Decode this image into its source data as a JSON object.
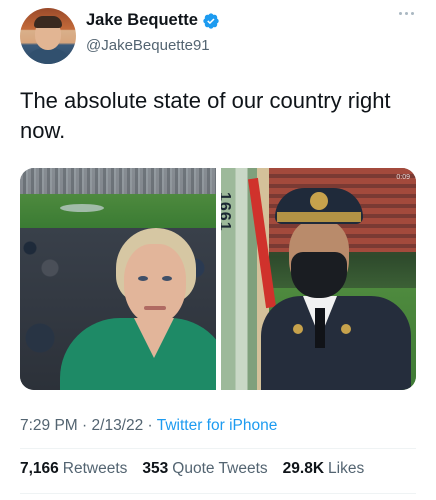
{
  "author": {
    "display_name": "Jake Bequette",
    "handle": "@JakeBequette91",
    "verified": true
  },
  "tweet": {
    "text": "The absolute state of our country right now."
  },
  "media": {
    "left_photo": "selfie-at-stadium",
    "right_photo": "soldier-honor-guard",
    "right_video_time": "0:09",
    "flag_text": "1661"
  },
  "meta": {
    "time": "7:29 PM",
    "separator_1": " · ",
    "date": "2/13/22",
    "separator_2": " · ",
    "source": "Twitter for iPhone"
  },
  "stats": {
    "retweets_count": "7,166",
    "retweets_label": "Retweets",
    "quote_count": "353",
    "quote_label": "Quote Tweets",
    "likes_count": "29.8K",
    "likes_label": "Likes"
  },
  "colors": {
    "accent": "#1d9bf0",
    "text_primary": "#0f1419",
    "text_secondary": "#536471",
    "divider": "#eff3f4"
  },
  "icons": {
    "verified": "verified-badge-icon",
    "more": "more-options-icon"
  }
}
